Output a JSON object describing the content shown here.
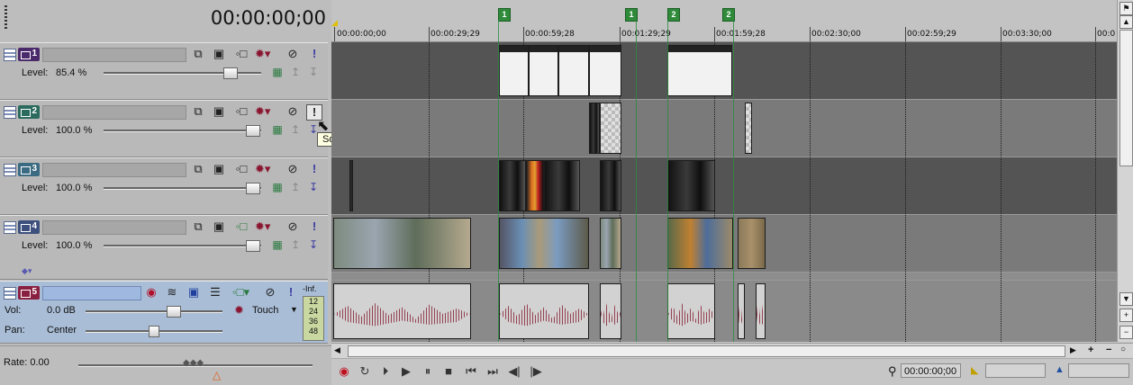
{
  "timecode": "00:00:00;00",
  "tracks": [
    {
      "number": "1",
      "level_label": "Level:",
      "level_value": "85.4 %",
      "color": "#4b2a6b"
    },
    {
      "number": "2",
      "level_label": "Level:",
      "level_value": "100.0 %",
      "color": "#2b6b5e"
    },
    {
      "number": "3",
      "level_label": "Level:",
      "level_value": "100.0 %",
      "color": "#3b6b82"
    },
    {
      "number": "4",
      "level_label": "Level:",
      "level_value": "100.0 %",
      "color": "#3d4f7d"
    },
    {
      "number": "5",
      "vol_label": "Vol:",
      "vol_value": "0.0 dB",
      "pan_label": "Pan:",
      "pan_value": "Center",
      "automation_mode": "Touch",
      "meter_top": "-Inf.",
      "meter_scale": [
        "12",
        "24",
        "36",
        "48"
      ],
      "color": "#8a2040"
    }
  ],
  "tooltip": "Solo",
  "rate_label": "Rate: 0.00",
  "ruler_labels": [
    "00:00:00;00",
    "00:00:29;29",
    "00:00:59;28",
    "00:01:29;29",
    "00:01:59;28",
    "00:02:30;00",
    "00:02:59;29",
    "00:03:30;00",
    "00:0"
  ],
  "markers": [
    "1",
    "1",
    "2",
    "2"
  ],
  "transport_timecode": "00:00:00;00",
  "colors": {
    "marker": "#2f8a3a",
    "audio_track_bg": "#a9bdd6",
    "waveform": "#8a2a3c"
  }
}
